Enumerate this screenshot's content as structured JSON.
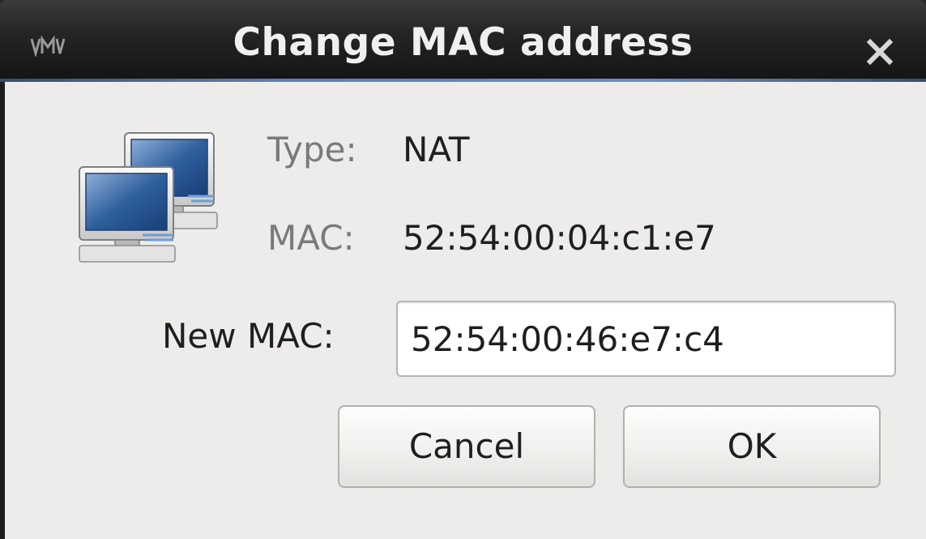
{
  "window": {
    "title": "Change MAC address"
  },
  "icons": {
    "app": "vm-app-icon",
    "close": "close-icon",
    "network": "network-computers-icon"
  },
  "info": {
    "type_label": "Type:",
    "type_value": "NAT",
    "mac_label": "MAC:",
    "mac_value": "52:54:00:04:c1:e7"
  },
  "form": {
    "new_mac_label": "New MAC:",
    "new_mac_value": "52:54:00:46:e7:c4"
  },
  "buttons": {
    "cancel_label": "Cancel",
    "ok_label": "OK"
  },
  "colors": {
    "titlebar": "#1a1a1a",
    "accent": "#6d8db8",
    "dialog_bg": "#edeceb"
  }
}
